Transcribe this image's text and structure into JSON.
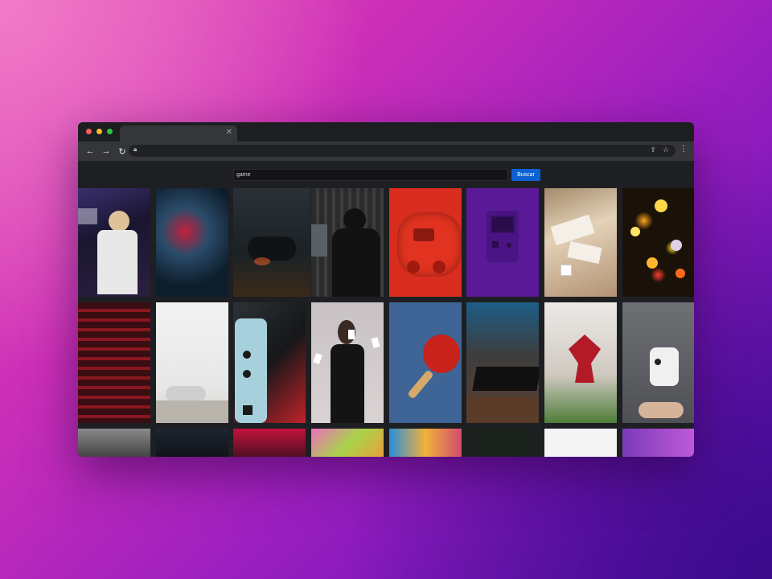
{
  "browser": {
    "window_controls": [
      {
        "name": "close",
        "color": "#ff5f57"
      },
      {
        "name": "minimize",
        "color": "#febc2e"
      },
      {
        "name": "maximize",
        "color": "#28c840"
      }
    ],
    "tab": {
      "title": "",
      "close_icon": "close-icon"
    },
    "toolbar": {
      "back_icon": "arrow-left-icon",
      "forward_icon": "arrow-right-icon",
      "reload_icon": "reload-icon",
      "url": "",
      "share_icon": "share-icon",
      "bookmark_icon": "star-icon",
      "menu_icon": "kebab-menu-icon"
    }
  },
  "page": {
    "search": {
      "value": "game",
      "button_label": "Buscar"
    },
    "gallery": {
      "rows": [
        {
          "images": [
            {
              "id": 1,
              "subject": "person-wearing-vr-headset"
            },
            {
              "id": 2,
              "subject": "neon-circuit-board"
            },
            {
              "id": 3,
              "subject": "controller-in-dark"
            },
            {
              "id": 4,
              "subject": "gamer-in-dark-room"
            },
            {
              "id": 5,
              "subject": "red-gamepad"
            },
            {
              "id": 6,
              "subject": "purple-game-boy"
            },
            {
              "id": 7,
              "subject": "cards-and-dice"
            },
            {
              "id": 8,
              "subject": "bokeh-lights"
            }
          ]
        },
        {
          "images": [
            {
              "id": 9,
              "subject": "slot-machines"
            },
            {
              "id": 10,
              "subject": "vr-headset-on-table"
            },
            {
              "id": 11,
              "subject": "handheld-console-buttons"
            },
            {
              "id": 12,
              "subject": "woman-with-playing-cards"
            },
            {
              "id": 13,
              "subject": "ping-pong-paddle"
            },
            {
              "id": 14,
              "subject": "gaming-desk-setup"
            },
            {
              "id": 15,
              "subject": "red-dragon-figurine"
            },
            {
              "id": 16,
              "subject": "floating-gamepad"
            }
          ]
        },
        {
          "images": [
            {
              "id": 17,
              "subject": "gray-image"
            },
            {
              "id": 18,
              "subject": "dark-image"
            },
            {
              "id": 19,
              "subject": "red-lit-keyboard"
            },
            {
              "id": 20,
              "subject": "colorful-sticky-notes"
            },
            {
              "id": 21,
              "subject": "arcade-lights"
            },
            {
              "id": 22,
              "subject": "dark-green-image"
            },
            {
              "id": 23,
              "subject": "white-image"
            },
            {
              "id": 24,
              "subject": "purple-image"
            }
          ]
        }
      ]
    }
  }
}
